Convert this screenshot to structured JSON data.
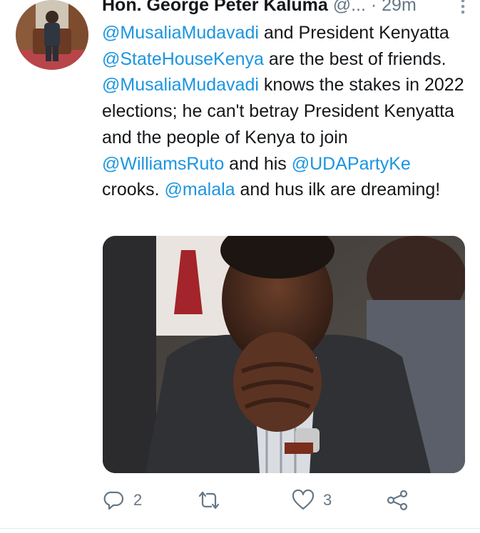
{
  "tweet": {
    "author_name": "Hon. George Peter Kaluma",
    "handle": "@...",
    "separator": "·",
    "time": "29m",
    "text_segments": [
      {
        "text": "@MusaliaMudavadi",
        "mention": true
      },
      {
        "text": " and President Kenyatta ",
        "mention": false
      },
      {
        "text": "@StateHouseKenya",
        "mention": true
      },
      {
        "text": " are the best of friends. ",
        "mention": false
      },
      {
        "text": "@MusaliaMudavadi",
        "mention": true
      },
      {
        "text": " knows the stakes in 2022 elections; he can't betray President Kenyatta and the people of Kenya to join ",
        "mention": false
      },
      {
        "text": "@WilliamsRuto",
        "mention": true
      },
      {
        "text": " and his ",
        "mention": false
      },
      {
        "text": "@UDAPartyKe",
        "mention": true
      },
      {
        "text": " crooks. ",
        "mention": false
      },
      {
        "text": "@malala",
        "mention": true
      },
      {
        "text": " and hus ilk are dreaming!",
        "mention": false
      }
    ]
  },
  "actions": {
    "reply_count": "2",
    "retweet_count": "",
    "like_count": "3",
    "icons": [
      "reply-icon",
      "retweet-icon",
      "like-icon",
      "share-icon"
    ]
  },
  "colors": {
    "mention": "#1b95e0",
    "muted": "#657786",
    "text": "#14171a"
  }
}
